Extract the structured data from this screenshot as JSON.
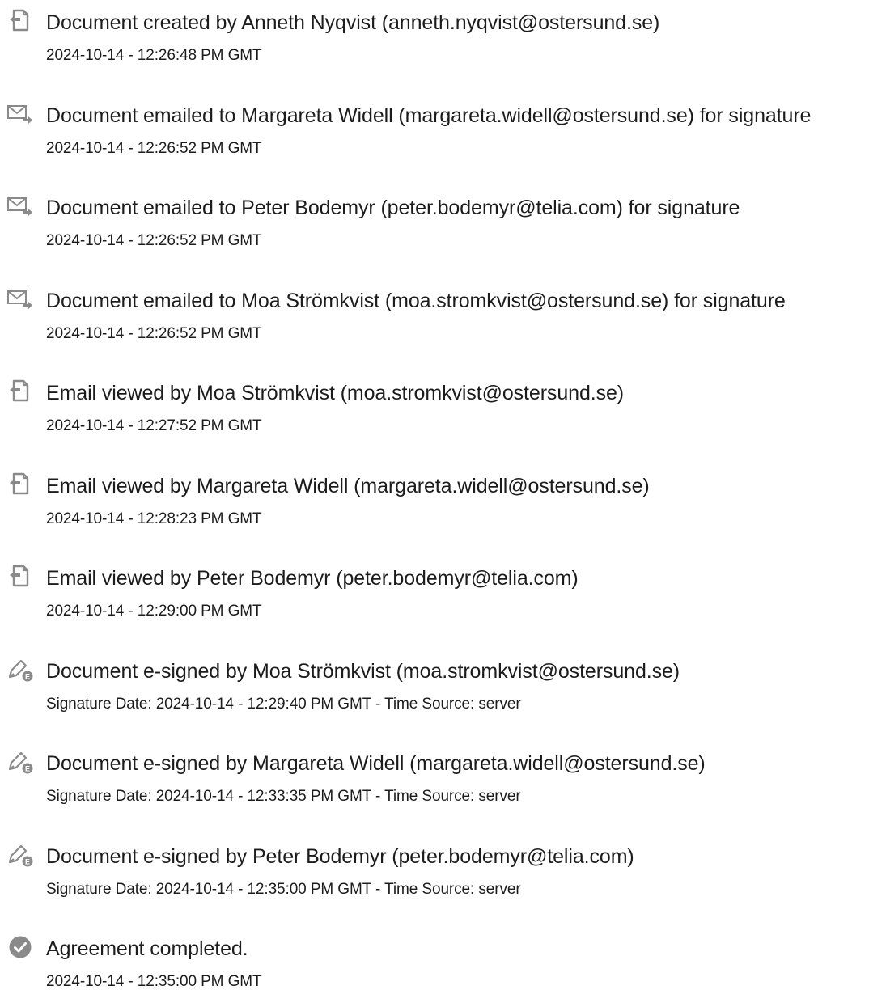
{
  "events": [
    {
      "icon": "document-icon",
      "title": "Document created by Anneth Nyqvist (anneth.nyqvist@ostersund.se)",
      "detail": "2024-10-14 - 12:26:48 PM GMT"
    },
    {
      "icon": "email-sent-icon",
      "title": "Document emailed to Margareta Widell (margareta.widell@ostersund.se) for signature",
      "detail": "2024-10-14 - 12:26:52 PM GMT"
    },
    {
      "icon": "email-sent-icon",
      "title": "Document emailed to Peter Bodemyr (peter.bodemyr@telia.com) for signature",
      "detail": "2024-10-14 - 12:26:52 PM GMT"
    },
    {
      "icon": "email-sent-icon",
      "title": "Document emailed to Moa Strömkvist (moa.stromkvist@ostersund.se) for signature",
      "detail": "2024-10-14 - 12:26:52 PM GMT"
    },
    {
      "icon": "document-icon",
      "title": "Email viewed by Moa Strömkvist (moa.stromkvist@ostersund.se)",
      "detail": "2024-10-14 - 12:27:52 PM GMT"
    },
    {
      "icon": "document-icon",
      "title": "Email viewed by Margareta Widell (margareta.widell@ostersund.se)",
      "detail": "2024-10-14 - 12:28:23 PM GMT"
    },
    {
      "icon": "document-icon",
      "title": "Email viewed by Peter Bodemyr (peter.bodemyr@telia.com)",
      "detail": "2024-10-14 - 12:29:00 PM GMT"
    },
    {
      "icon": "esign-icon",
      "title": "Document e-signed by Moa Strömkvist (moa.stromkvist@ostersund.se)",
      "detail": "Signature Date: 2024-10-14 - 12:29:40 PM GMT - Time Source: server"
    },
    {
      "icon": "esign-icon",
      "title": "Document e-signed by Margareta Widell (margareta.widell@ostersund.se)",
      "detail": "Signature Date: 2024-10-14 - 12:33:35 PM GMT - Time Source: server"
    },
    {
      "icon": "esign-icon",
      "title": "Document e-signed by Peter Bodemyr (peter.bodemyr@telia.com)",
      "detail": "Signature Date: 2024-10-14 - 12:35:00 PM GMT - Time Source: server"
    },
    {
      "icon": "checkmark-circle-icon",
      "title": "Agreement completed.",
      "detail": "2024-10-14 - 12:35:00 PM GMT"
    }
  ]
}
